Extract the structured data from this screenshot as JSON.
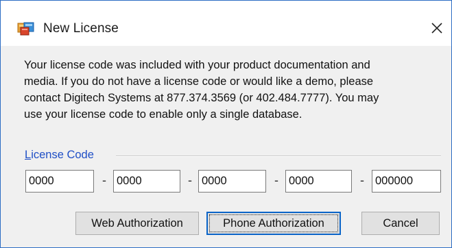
{
  "window": {
    "title": "New License",
    "icon": "license-key-icon",
    "close_icon": "close-icon"
  },
  "message": {
    "lines": [
      "Your license code was included with your product documentation and",
      "media.  If you do not have a license code or would like a demo, please",
      "contact Digitech Systems at 877.374.3569 (or 402.484.7777).  You may",
      "use your license code to enable only a single database."
    ]
  },
  "license_code": {
    "label_underlined": "L",
    "label_rest": "icense Code",
    "fields": [
      "0000",
      "0000",
      "0000",
      "0000",
      "000000"
    ],
    "separator": "-"
  },
  "buttons": {
    "web_authorization": "Web Authorization",
    "phone_authorization": "Phone Authorization",
    "cancel": "Cancel"
  },
  "colors": {
    "accent": "#1f4fc6",
    "window_border": "#2b6cc4",
    "default_button_border": "#0a64c8"
  }
}
